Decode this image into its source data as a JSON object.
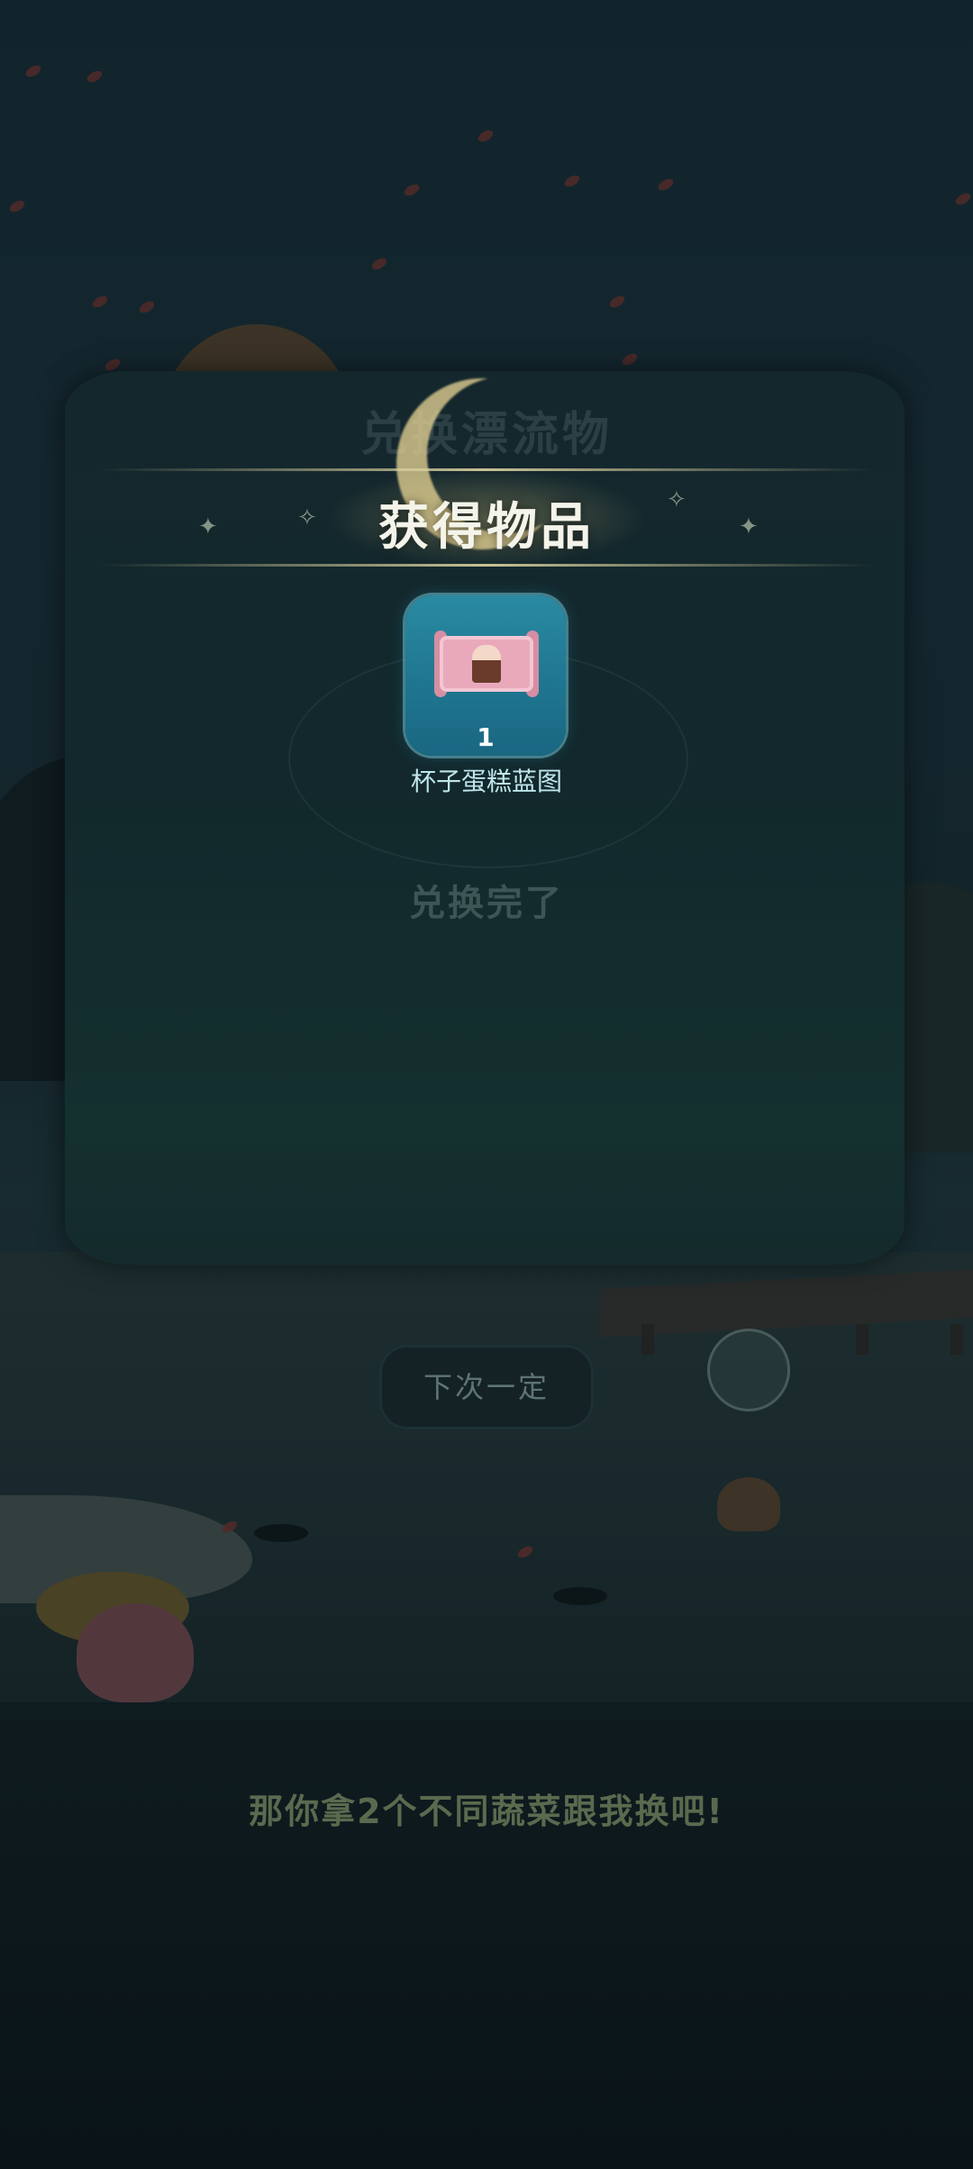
{
  "popup": {
    "background_title": "兑换漂流物",
    "title": "获得物品",
    "item": {
      "name": "杯子蛋糕蓝图",
      "count": "1",
      "icon": "cupcake-blueprint-scroll-icon"
    },
    "status": "兑换完了"
  },
  "button": {
    "next_label": "下次一定"
  },
  "dialog": {
    "text": "那你拿2个不同蔬菜跟我换吧!"
  },
  "colors": {
    "tile": "#1f7690",
    "title_text": "#f4f4ea",
    "item_name_text": "#bfe6ea",
    "dialog_text": "#5a6a4e"
  }
}
